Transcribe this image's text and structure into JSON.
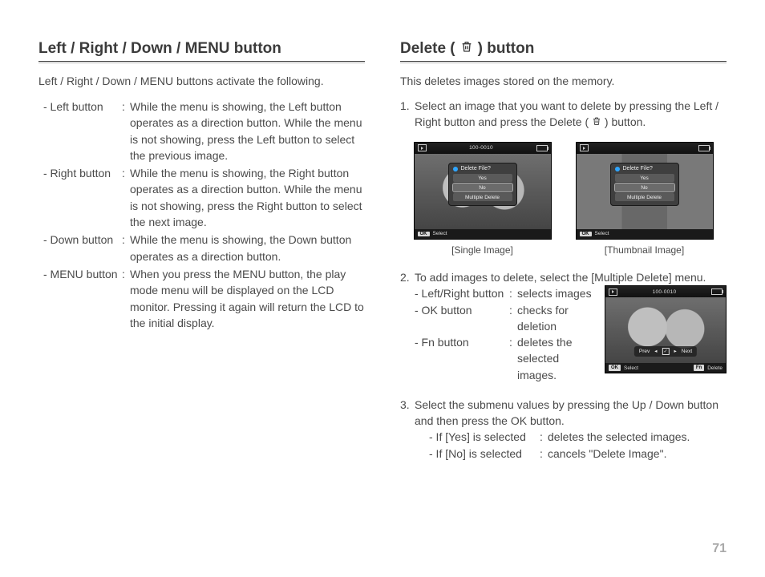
{
  "page_number": "71",
  "left": {
    "heading": "Left / Right / Down / MENU button",
    "intro": "Left / Right / Down / MENU buttons activate the following.",
    "items": [
      {
        "term": "- Left button",
        "desc": "While the menu is showing, the Left button operates as a direction button. While the menu is not showing, press the Left button to select the previous image."
      },
      {
        "term": "- Right button",
        "desc": "While the menu is showing, the Right button operates as a direction button. While the menu is not showing, press the Right button to select the next image."
      },
      {
        "term": "- Down button",
        "desc": "While the menu is showing, the Down button operates as a direction button."
      },
      {
        "term": "- MENU button",
        "desc": "When you press the MENU button, the play mode menu will be displayed on the LCD monitor. Pressing it again will return the LCD to the initial display."
      }
    ]
  },
  "right": {
    "heading_pre": "Delete (",
    "heading_post": ") button",
    "intro": "This deletes images stored on the memory.",
    "step1_pre": "Select an image that you want to delete by pressing the Left / Right button and press the Delete (",
    "step1_post": ") button.",
    "shots": {
      "single_caption": "[Single Image]",
      "thumb_caption": "[Thumbnail Image]",
      "file_counter": "100-0010",
      "dialog_title": "Delete File?",
      "opt_yes": "Yes",
      "opt_no": "No",
      "opt_multi": "Multiple Delete",
      "ok_label": "OK",
      "select_label": "Select",
      "fn_label": "Fn",
      "delete_label": "Delete",
      "prev_label": "Prev",
      "next_label": "Next"
    },
    "step2_lead": "To add images to delete, select the [Multiple Delete] menu.",
    "step2_rows": [
      {
        "label": "- Left/Right button",
        "desc": "selects images"
      },
      {
        "label": "- OK button",
        "desc": "checks for deletion"
      },
      {
        "label": "- Fn button",
        "desc": "deletes the selected images."
      }
    ],
    "step3_lead": "Select the submenu values by pressing the Up / Down button and then press the OK button.",
    "step3_rows": [
      {
        "label": "- If [Yes] is selected",
        "desc": "deletes the selected images."
      },
      {
        "label": "- If [No] is selected",
        "desc": "cancels \"Delete Image\"."
      }
    ]
  }
}
